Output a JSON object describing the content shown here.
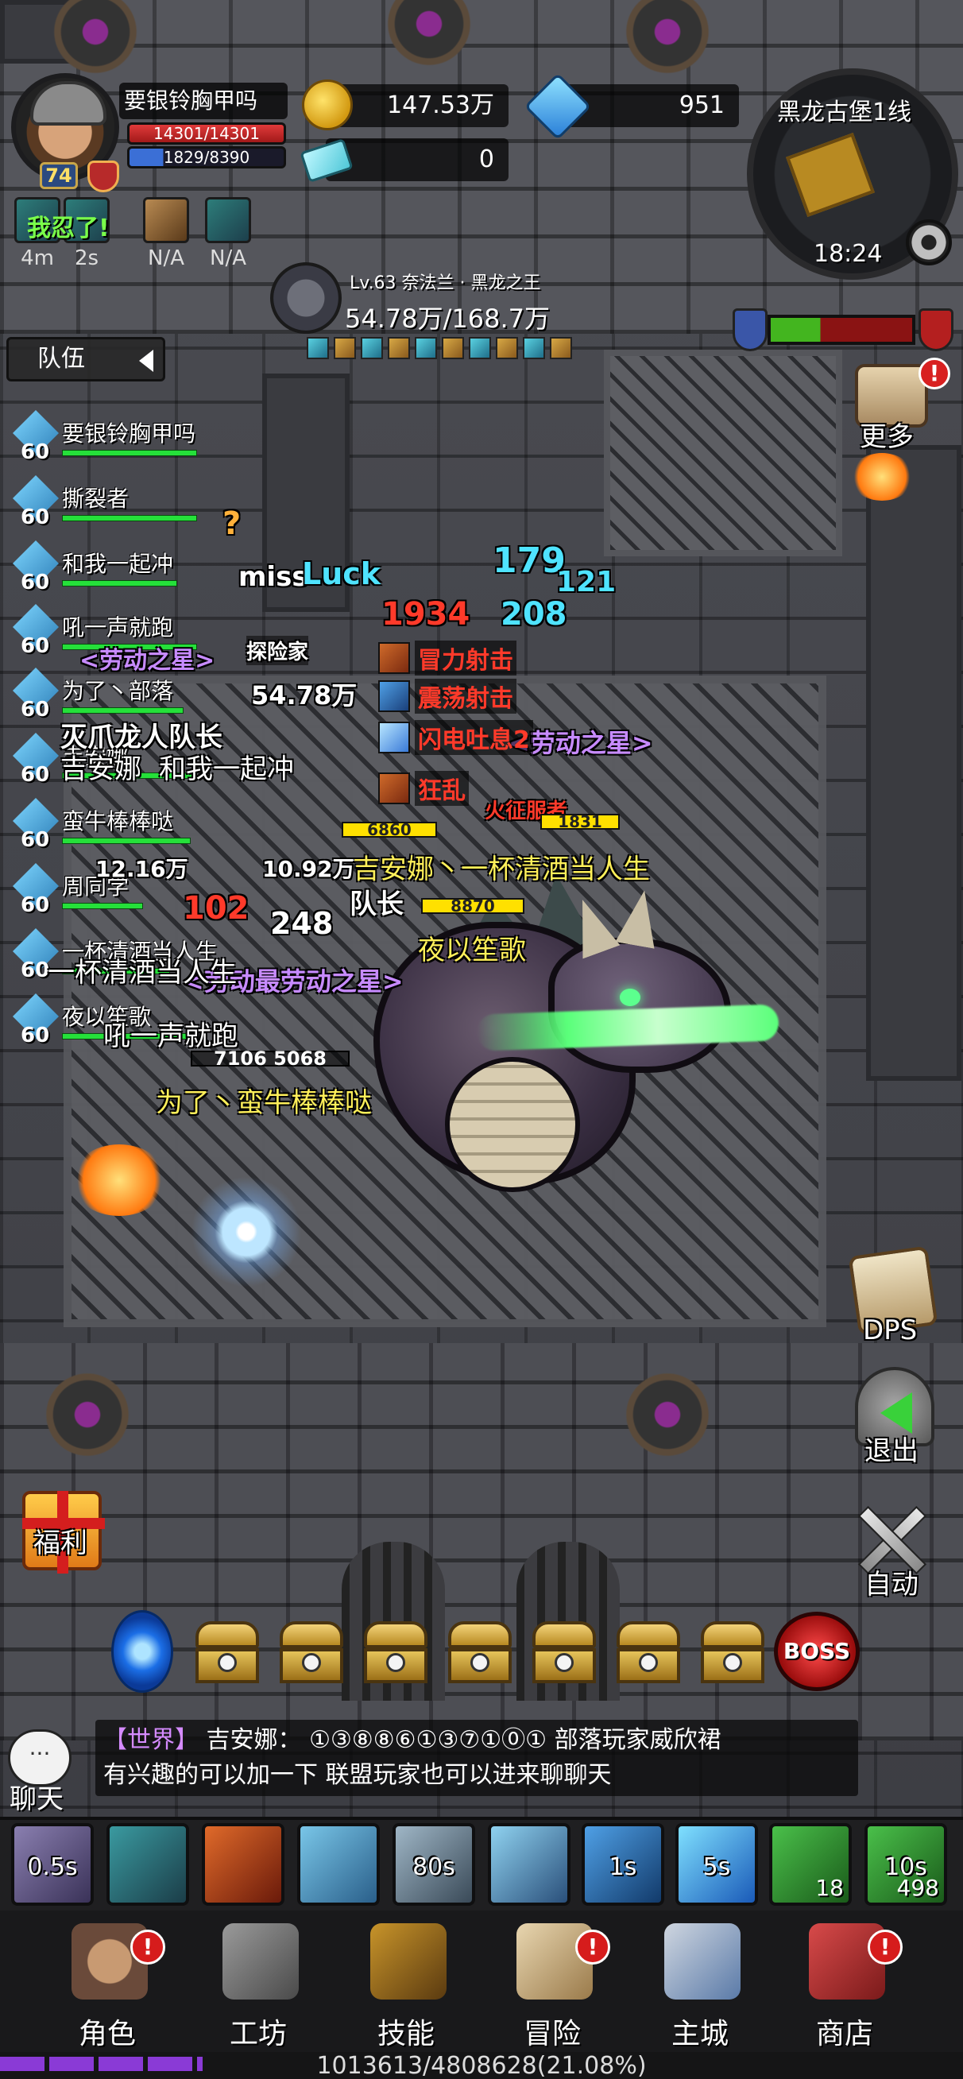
{
  "player": {
    "name": "要银铃胸甲吗",
    "level": "74",
    "hp_text": "14301/14301",
    "mp_text": "1829/8390"
  },
  "currency": {
    "gold": "147.53万",
    "diamonds": "951",
    "tickets": "0"
  },
  "buffs": [
    {
      "icon": "teal-rune-icon",
      "timer": "4m"
    },
    {
      "icon": "wind-buff-icon",
      "timer": "2s"
    },
    {
      "icon": "chest-buff-icon",
      "timer": "N/A"
    },
    {
      "icon": "blade-buff-icon",
      "timer": "N/A"
    }
  ],
  "buff_overlay_text": "我忍了!",
  "minimap": {
    "title": "黑龙古堡1线",
    "time": "18:24"
  },
  "boss": {
    "name": "Lv.63 奈法兰 · 黑龙之王",
    "hp_text": "54.78万/168.7万"
  },
  "team": {
    "tab_label": "队伍",
    "members": [
      {
        "level": "60",
        "name": "要银铃胸甲吗",
        "hp": 1.0
      },
      {
        "level": "60",
        "name": "撕裂者",
        "hp": 1.0
      },
      {
        "level": "60",
        "name": "和我一起冲",
        "hp": 0.85
      },
      {
        "level": "60",
        "name": "吼一声就跑",
        "hp": 1.0
      },
      {
        "level": "60",
        "name": "为了丶部落",
        "hp": 0.9
      },
      {
        "level": "60",
        "name": "吉安娜",
        "hp": 1.0
      },
      {
        "level": "60",
        "name": "蛮牛棒棒哒",
        "hp": 0.95
      },
      {
        "level": "60",
        "name": "周同学",
        "hp": 0.6
      },
      {
        "level": "60",
        "name": "一杯清酒当人生",
        "hp": 0.8
      },
      {
        "level": "60",
        "name": "夜以笙歌",
        "hp": 0.95
      }
    ]
  },
  "combat_text": {
    "miss": "miss",
    "luck": "Luck",
    "n1": "179",
    "n2": "121",
    "n3": "1934",
    "n4": "208",
    "n5": "6860",
    "n6": "1831",
    "n7": "8870",
    "n8": "12.16万",
    "n9": "10.92万",
    "n10": "248",
    "n11": "7106",
    "n12": "5068",
    "boss_hp_overlay": "54.78万",
    "title1": "<劳动之星>",
    "title2": "<劳动之星>",
    "title3": "<劳动最劳动之星>",
    "explorer": "探险家",
    "conqueror": "火征服者",
    "team_leader": "队长",
    "dragon_tag": "灭爪龙人队长"
  },
  "skill_popups": [
    "冒力射击",
    "震荡射击",
    "闪电吐息2",
    "狂乱"
  ],
  "name_tags": {
    "jaina_drink": "吉安娜丶一杯清酒当人生",
    "yeyi": "夜以笙歌",
    "for_horde_taurus": "为了丶蛮牛棒棒哒",
    "jaina": "吉安娜",
    "with_me": "和我一起冲",
    "zhou": "周同学",
    "roar_run": "吼一声就跑",
    "drink": "一杯清酒当人生"
  },
  "right_menu": {
    "more": "更多",
    "dps": "DPS",
    "exit": "退出",
    "auto": "自动"
  },
  "left_menu": {
    "welfare": "福利"
  },
  "boss_node": "BOSS",
  "chat": {
    "label": "聊天",
    "bubble": "···",
    "channel": "【世界】",
    "sender": "吉安娜：",
    "line1": "①③⑧⑧⑥①③⑦①⓪① 部落玩家威欣裙",
    "line2": "有兴趣的可以加一下 联盟玩家也可以进来聊聊天"
  },
  "skills": [
    {
      "icon": "arrow-volley-icon",
      "cd": "0.5s",
      "count": ""
    },
    {
      "icon": "serpent-sting-icon",
      "cd": "",
      "count": ""
    },
    {
      "icon": "target-mark-icon",
      "cd": "",
      "count": ""
    },
    {
      "icon": "hunter-trap-icon",
      "cd": "",
      "count": ""
    },
    {
      "icon": "spear-strike-icon",
      "cd": "80s",
      "count": ""
    },
    {
      "icon": "multi-shot-icon",
      "cd": "",
      "count": ""
    },
    {
      "icon": "piercing-arrow-icon",
      "cd": "1s",
      "count": ""
    },
    {
      "icon": "ice-crystal-icon",
      "cd": "5s",
      "count": ""
    },
    {
      "icon": "bread-food-icon",
      "cd": "",
      "count": "18"
    },
    {
      "icon": "potion-icon",
      "cd": "10s",
      "count": "498"
    }
  ],
  "nav": [
    {
      "label": "角色",
      "icon": "character-icon",
      "alert": "!"
    },
    {
      "label": "工坊",
      "icon": "anvil-icon",
      "alert": ""
    },
    {
      "label": "技能",
      "icon": "skill-book-icon",
      "alert": ""
    },
    {
      "label": "冒险",
      "icon": "map-scroll-icon",
      "alert": "!"
    },
    {
      "label": "主城",
      "icon": "castle-icon",
      "alert": ""
    },
    {
      "label": "商店",
      "icon": "shop-icon",
      "alert": "!"
    }
  ],
  "xp": {
    "text": "1013613/4808628(21.08%)",
    "fraction": 0.2108
  },
  "colors": {
    "hp_green": "#25e03a",
    "damage_orange": "#ffb13a",
    "crit_red": "#ff3a2a",
    "heal_cyan": "#4fe3ff",
    "world_channel": "#d58bff",
    "xp_purple": "#8a3ad6"
  }
}
